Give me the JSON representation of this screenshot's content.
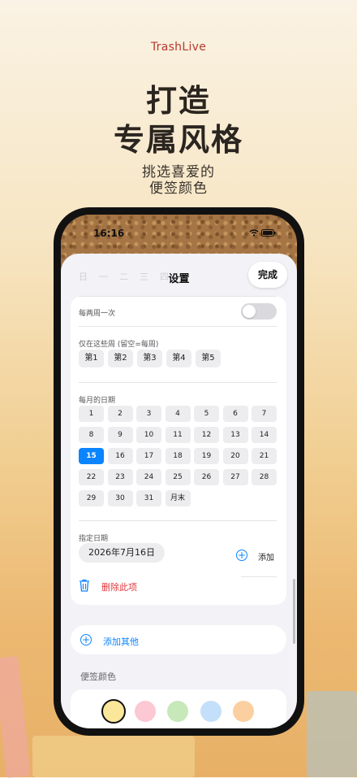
{
  "brand": "TrashLive",
  "headline": [
    "打造",
    "专属风格"
  ],
  "subline": [
    "挑选喜爱的",
    "便签颜色"
  ],
  "status": {
    "time": "16:16"
  },
  "sheet": {
    "title": "设置",
    "done_label": "完成",
    "week_header": [
      "日",
      "一",
      "二",
      "三",
      "四",
      "五",
      "六"
    ]
  },
  "biweekly": {
    "label": "每两周一次",
    "on": false
  },
  "weeks": {
    "label": "仅在这些周 (留空=每周)",
    "items": [
      "第1",
      "第2",
      "第3",
      "第4",
      "第5"
    ]
  },
  "monthday": {
    "label": "每月的日期",
    "days": [
      "1",
      "2",
      "3",
      "4",
      "5",
      "6",
      "7",
      "8",
      "9",
      "10",
      "11",
      "12",
      "13",
      "14",
      "15",
      "16",
      "17",
      "18",
      "19",
      "20",
      "21",
      "22",
      "23",
      "24",
      "25",
      "26",
      "27",
      "28",
      "29",
      "30",
      "31",
      "月末"
    ],
    "selected": "15"
  },
  "specific": {
    "label": "指定日期",
    "date": "2026年7月16日",
    "add_label": "添加"
  },
  "delete_label": "删除此项",
  "add_other_label": "添加其他",
  "note_color": {
    "label": "便签颜色",
    "swatches": [
      "#fbe79a",
      "#fbc8d3",
      "#c7e8b9",
      "#c4dffa",
      "#fbcf9f"
    ],
    "selected_index": 0
  }
}
